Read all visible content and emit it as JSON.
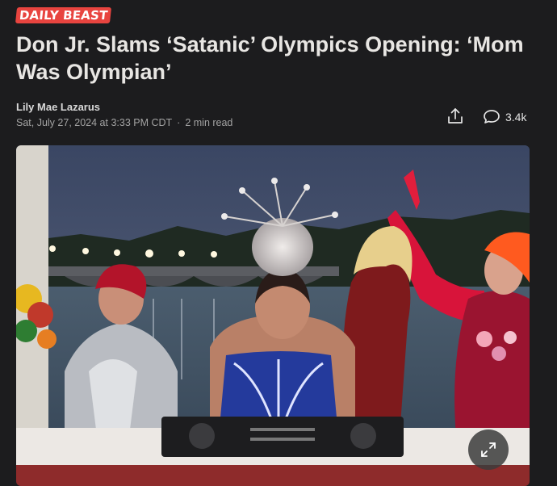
{
  "brand": {
    "logo_text": "DAILY BEAST",
    "accent": "#e8443f"
  },
  "article": {
    "headline": "Don Jr. Slams ‘Satanic’ Olympics Opening: ‘Mom Was Olympian’",
    "author": "Lily Mae Lazarus",
    "date": "Sat, July 27, 2024 at 3:33 PM CDT",
    "separator": "·",
    "read_time": "2 min read"
  },
  "actions": {
    "share_icon": "share-icon",
    "comment_icon": "comment-bubble-icon",
    "comment_count": "3.4k"
  },
  "media": {
    "type": "image",
    "expand_icon": "expand-icon"
  },
  "colors": {
    "background": "#1c1c1e",
    "headline": "#e8e6e3",
    "meta": "#a3a3a3"
  }
}
